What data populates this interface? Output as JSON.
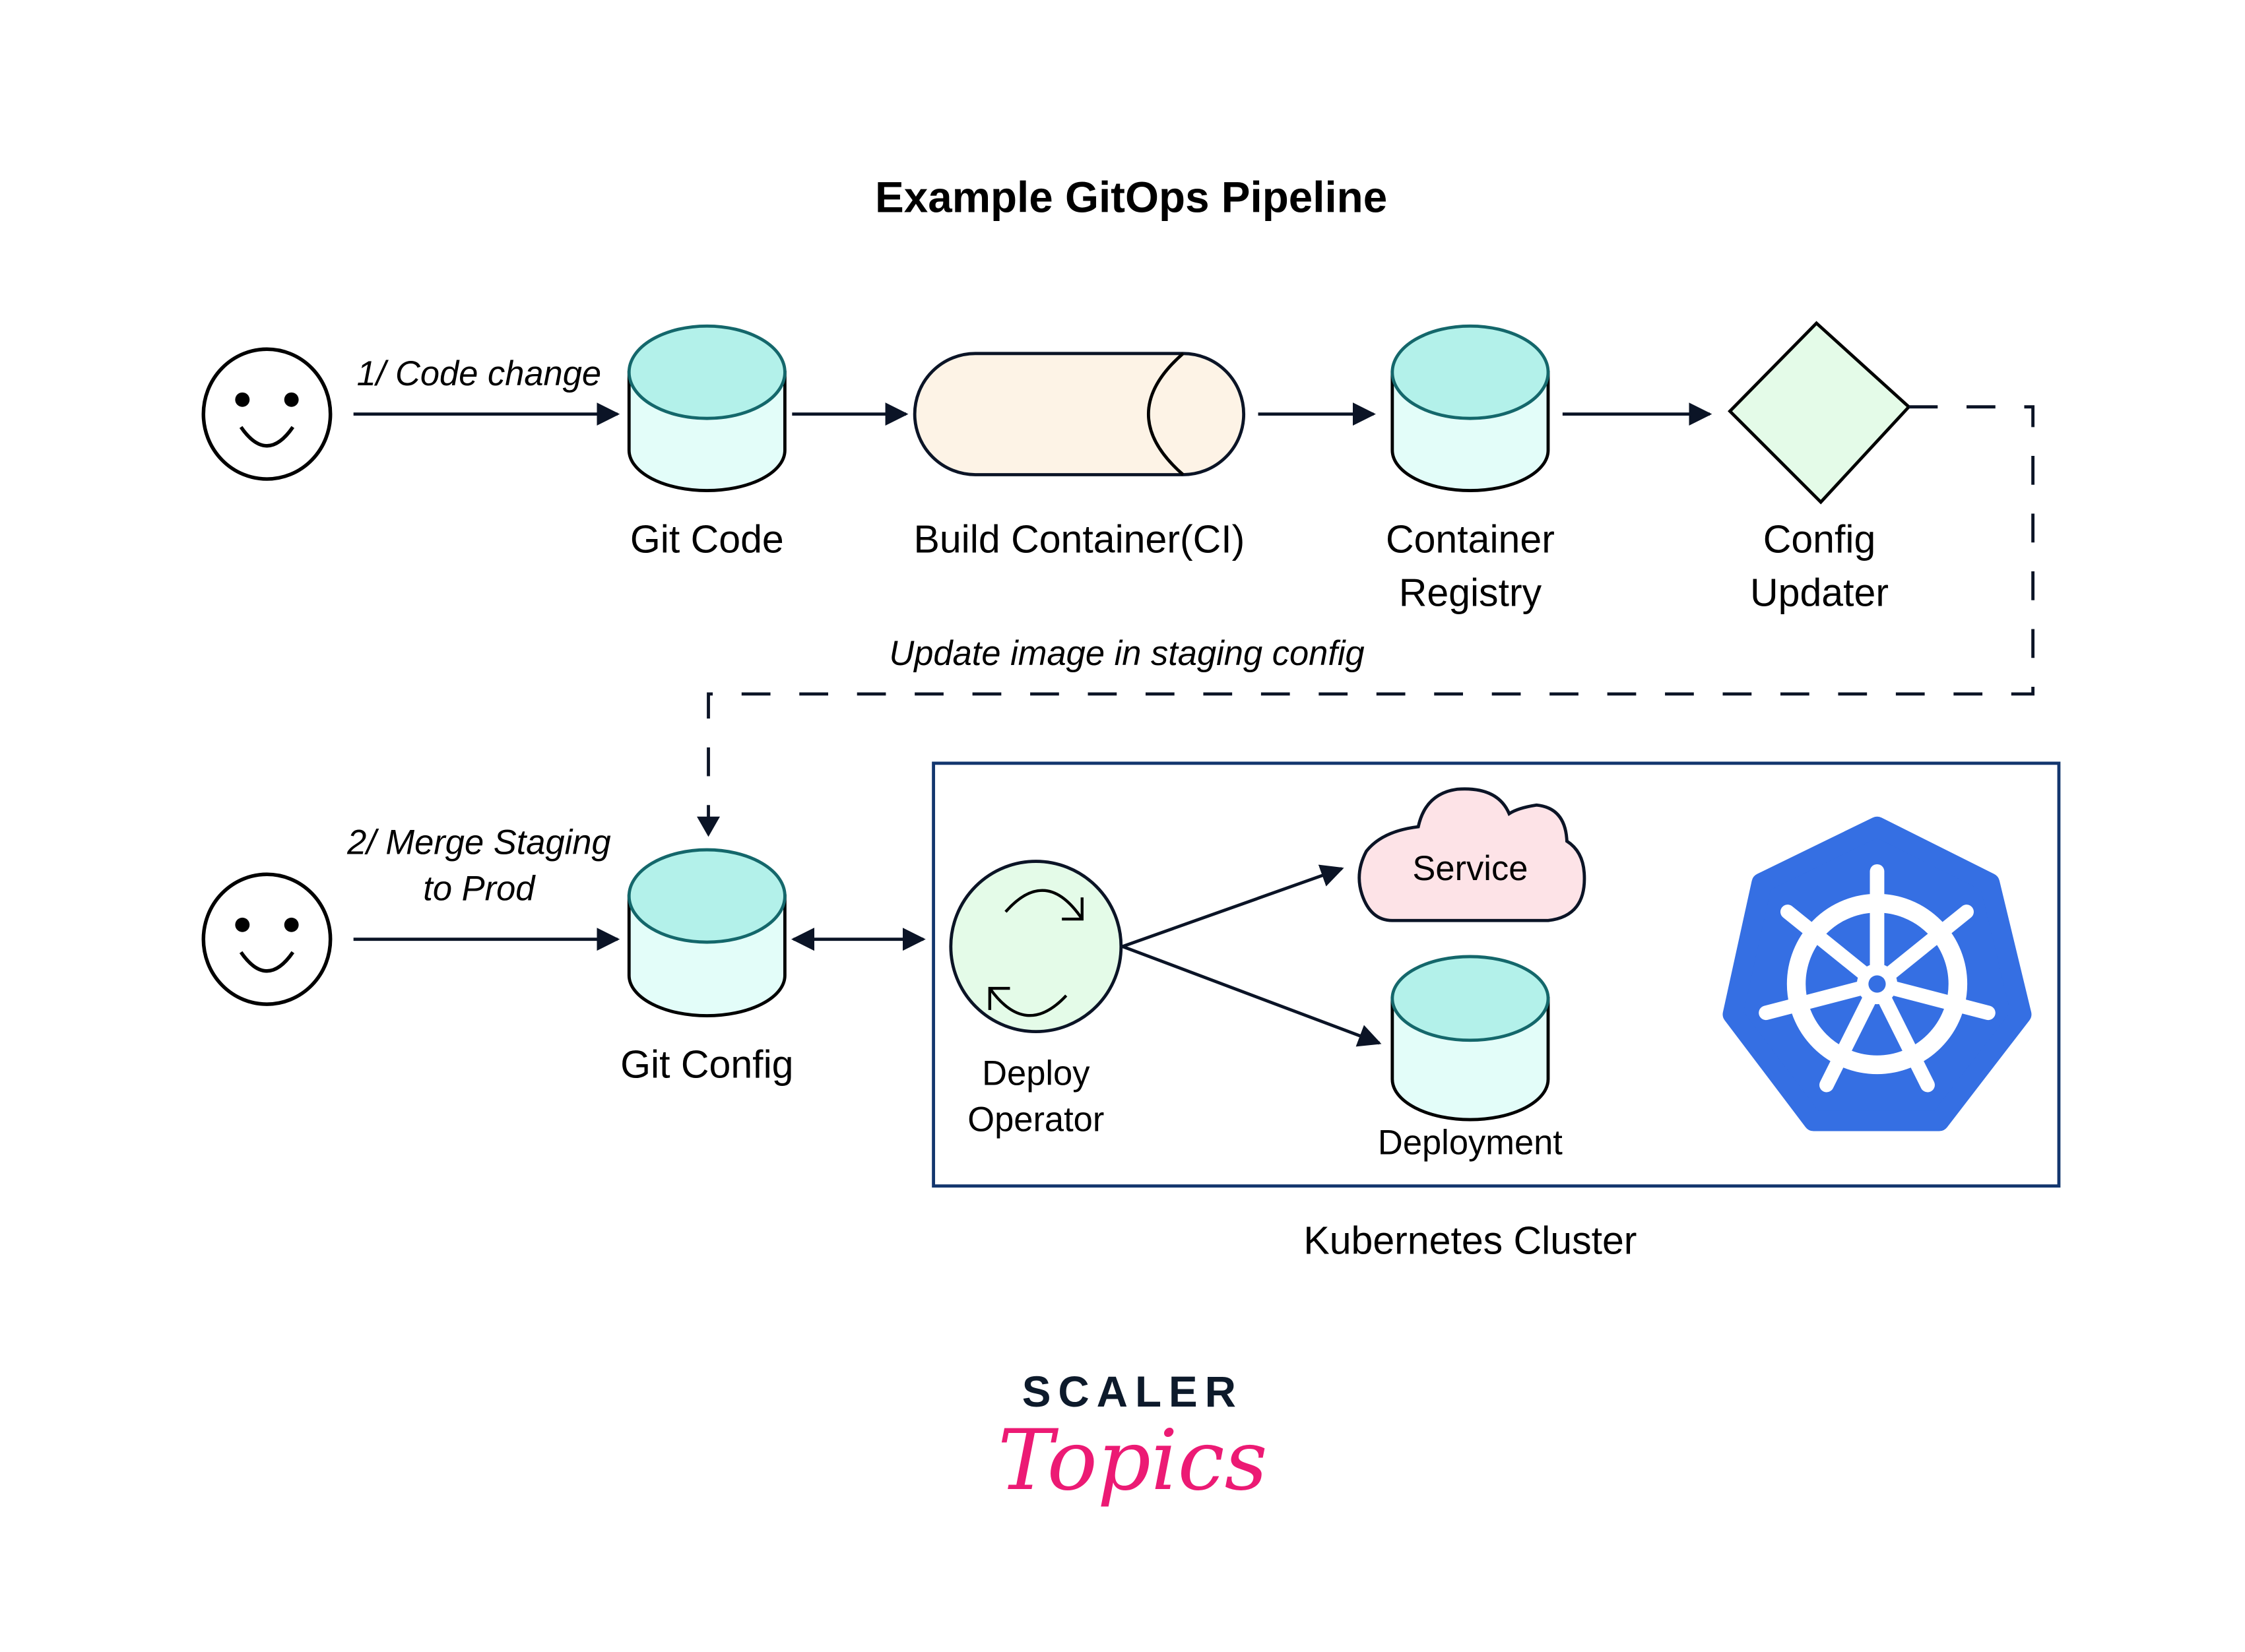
{
  "title": "Example GitOps Pipeline",
  "colors": {
    "stroke": "#0b1426",
    "cylinder_top": "#b3f1ea",
    "cylinder_top_stroke": "#14676b",
    "cylinder_body": "#e3fdf9",
    "build_fill": "#fdf3e6",
    "diamond_fill": "#e4fbe8",
    "operator_fill": "#e4fbe8",
    "service_fill": "#fde3e7",
    "cluster_border": "#13366e",
    "k8s_blue": "#356fe3",
    "brand_dark": "#0d1a2b",
    "brand_pink": "#ec1a74"
  },
  "row1": {
    "actor_icon": "smiley-face-icon",
    "edge_label": "1/ Code change",
    "nodes": [
      {
        "id": "git-code",
        "shape": "cylinder",
        "label": [
          "Git Code"
        ]
      },
      {
        "id": "build-container",
        "shape": "horizontal-cylinder",
        "label": [
          "Build Container(CI)"
        ]
      },
      {
        "id": "container-registry",
        "shape": "cylinder",
        "label": [
          "Container",
          "Registry"
        ]
      },
      {
        "id": "config-updater",
        "shape": "diamond",
        "label": [
          "Config",
          "Updater"
        ]
      }
    ]
  },
  "dashed_edge_label": "Update image in staging config",
  "row2": {
    "actor_icon": "smiley-face-icon",
    "edge_label": [
      "2/ Merge Staging",
      "to Prod"
    ],
    "git_config": {
      "shape": "cylinder",
      "label": [
        "Git Config"
      ]
    }
  },
  "cluster": {
    "label": "Kubernetes Cluster",
    "operator": {
      "shape": "circle",
      "icon": "refresh-cycle-icon",
      "label": [
        "Deploy",
        "Operator"
      ]
    },
    "service": {
      "shape": "cloud",
      "label": "Service"
    },
    "deployment": {
      "shape": "cylinder",
      "label": "Deployment"
    },
    "logo": "kubernetes-helm-logo"
  },
  "brand": {
    "line1": "SCALER",
    "line2": "Topics"
  }
}
